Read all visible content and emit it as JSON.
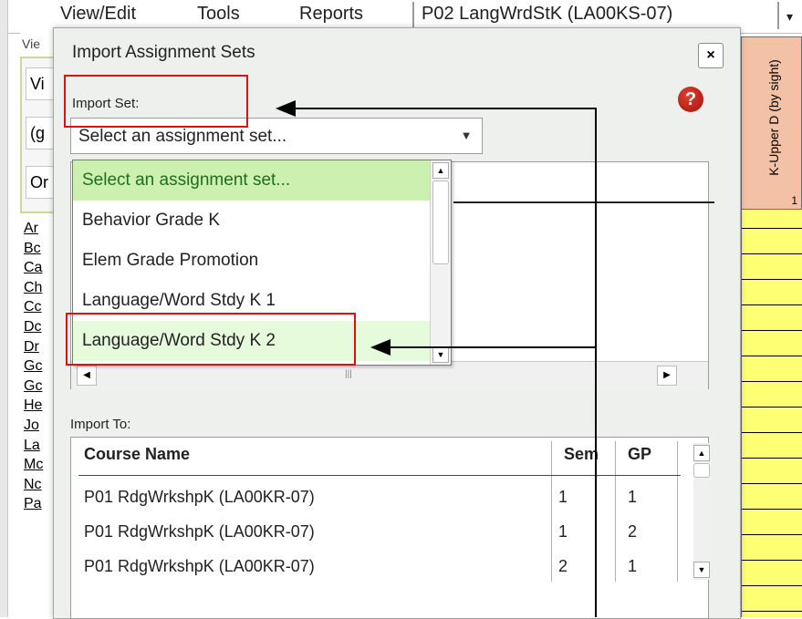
{
  "background_app": {
    "menu": [
      "View/Edit",
      "Tools",
      "Reports"
    ],
    "course_tab": "P02  LangWrdStK (LA00KS-07)",
    "left_top_tab": "Vie",
    "left_fields": [
      "Vi",
      "(g",
      "Or"
    ],
    "left_links": [
      "Ar",
      "Bc",
      "Ca",
      "Ch",
      "Cc",
      "Dc",
      "Dr",
      "Gc",
      "Gc",
      "He",
      "Jo",
      "La",
      "Mc",
      "Nc",
      "Pa"
    ],
    "right_column_header": "K-Upper D (by sight)",
    "right_column_number": "1"
  },
  "dialog": {
    "title": "Import Assignment Sets",
    "close_label": "×",
    "help_label": "?",
    "import_set_label": "Import Set:",
    "select_value": "Select an assignment set...",
    "dropdown_options": [
      "Select an assignment set...",
      "Behavior Grade K",
      "Elem Grade Promotion",
      "Language/Word Stdy K 1",
      "Language/Word Stdy K 2"
    ],
    "import_to_label": "Import To:",
    "table": {
      "headers": [
        "Course Name",
        "Sem",
        "GP"
      ],
      "rows": [
        {
          "course": "P01  RdgWrkshpK (LA00KR-07)",
          "sem": "1",
          "gp": "1"
        },
        {
          "course": "P01  RdgWrkshpK (LA00KR-07)",
          "sem": "1",
          "gp": "2"
        },
        {
          "course": "P01  RdgWrkshpK (LA00KR-07)",
          "sem": "2",
          "gp": "1"
        }
      ]
    }
  },
  "colors": {
    "dialog_bg": "#eef0ee",
    "selected_option_bg": "#ccf0b0",
    "highlight_option_bg": "#e6fadc",
    "annotation_red": "#e01010",
    "column_header": "#f3c2a6",
    "column_cells": "#ffff74"
  }
}
